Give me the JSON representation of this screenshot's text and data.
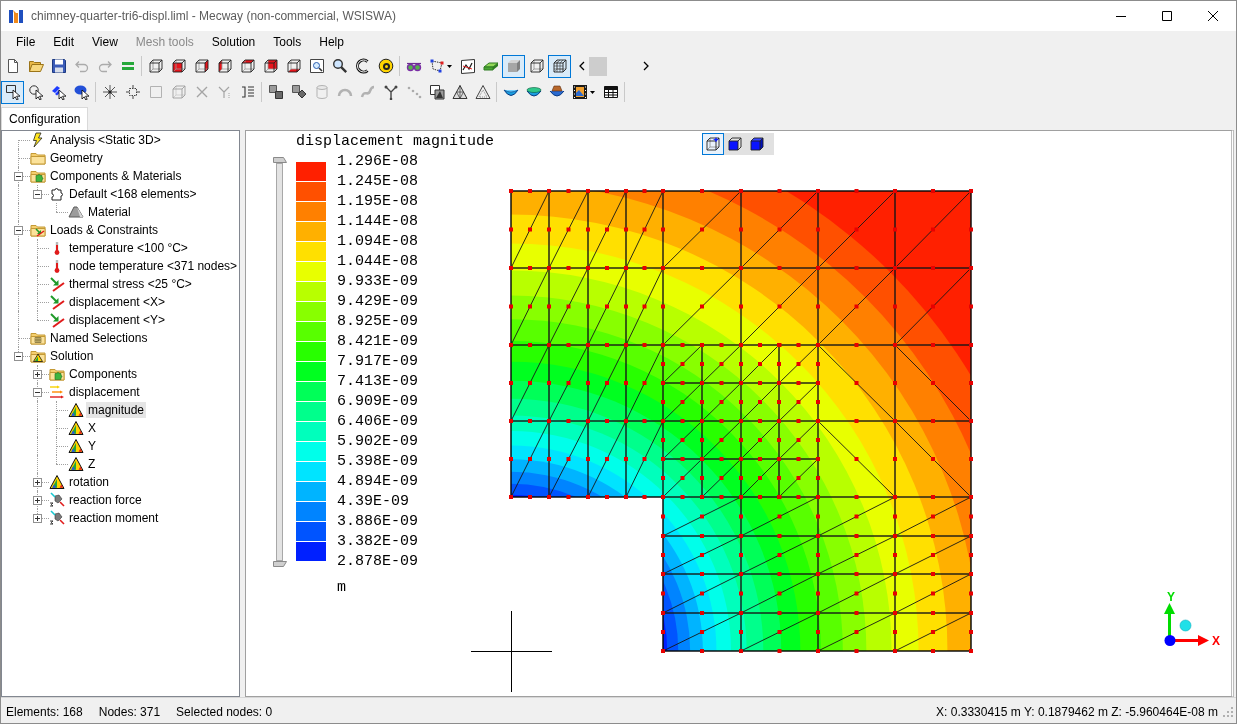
{
  "window": {
    "title": "chimney-quarter-tri6-displ.liml - Mecway (non-commercial, WSISWA)"
  },
  "menu": [
    {
      "label": "File",
      "disabled": false
    },
    {
      "label": "Edit",
      "disabled": false
    },
    {
      "label": "View",
      "disabled": false
    },
    {
      "label": "Mesh tools",
      "disabled": true
    },
    {
      "label": "Solution",
      "disabled": false
    },
    {
      "label": "Tools",
      "disabled": false
    },
    {
      "label": "Help",
      "disabled": false
    }
  ],
  "toolbars": [
    {
      "groups": [
        [
          {
            "selected": false,
            "disabled": false
          },
          {
            "selected": false,
            "disabled": false
          },
          {
            "selected": false,
            "disabled": false
          },
          {
            "selected": false,
            "disabled": true
          },
          {
            "selected": false,
            "disabled": true
          },
          {
            "selected": false,
            "disabled": false
          }
        ],
        [
          {
            "selected": false,
            "disabled": false
          },
          {
            "selected": false,
            "disabled": false
          },
          {
            "selected": false,
            "disabled": false
          },
          {
            "selected": false,
            "disabled": false
          },
          {
            "selected": false,
            "disabled": false
          },
          {
            "selected": false,
            "disabled": false
          },
          {
            "selected": false,
            "disabled": false
          },
          {
            "selected": false,
            "disabled": false
          },
          {
            "selected": false,
            "disabled": false
          },
          {
            "selected": false,
            "disabled": false
          },
          {
            "selected": false,
            "disabled": false
          }
        ],
        [
          {
            "selected": false,
            "disabled": false
          },
          {
            "selected": false,
            "disabled": false
          },
          {
            "selected": false,
            "disabled": false
          },
          {
            "selected": false,
            "disabled": false
          },
          {
            "selected": true,
            "disabled": false
          },
          {
            "selected": false,
            "disabled": false
          },
          {
            "selected": true,
            "disabled": false
          }
        ]
      ]
    },
    {
      "groups": [
        [
          {
            "selected": true,
            "disabled": false
          },
          {
            "selected": false,
            "disabled": false
          },
          {
            "selected": false,
            "disabled": false
          },
          {
            "selected": false,
            "disabled": false
          }
        ],
        [
          {
            "selected": false,
            "disabled": false
          },
          {
            "selected": false,
            "disabled": false
          },
          {
            "selected": false,
            "disabled": true
          },
          {
            "selected": false,
            "disabled": true
          },
          {
            "selected": false,
            "disabled": true
          },
          {
            "selected": false,
            "disabled": true
          },
          {
            "selected": false,
            "disabled": false
          }
        ],
        [
          {
            "selected": false,
            "disabled": false
          },
          {
            "selected": false,
            "disabled": false
          },
          {
            "selected": false,
            "disabled": true
          },
          {
            "selected": false,
            "disabled": true
          },
          {
            "selected": false,
            "disabled": true
          },
          {
            "selected": false,
            "disabled": false
          },
          {
            "selected": false,
            "disabled": true
          },
          {
            "selected": false,
            "disabled": false
          },
          {
            "selected": false,
            "disabled": false
          },
          {
            "selected": false,
            "disabled": false
          }
        ],
        [
          {
            "selected": false,
            "disabled": false
          },
          {
            "selected": false,
            "disabled": false
          },
          {
            "selected": false,
            "disabled": false
          },
          {
            "selected": false,
            "disabled": false
          },
          {
            "selected": false,
            "disabled": false
          }
        ]
      ]
    }
  ],
  "tabs": [
    {
      "label": "Configuration",
      "selected": true
    }
  ],
  "tree": [
    {
      "label": "Analysis <Static 3D>",
      "kind": "analysis",
      "selected": false
    },
    {
      "label": "Geometry",
      "kind": "folder",
      "selected": false
    },
    {
      "label": "Components & Materials",
      "kind": "components",
      "selected": false,
      "expanded": true,
      "children": [
        {
          "label": "Default <168 elements>",
          "kind": "part",
          "selected": false,
          "expanded": true,
          "children": [
            {
              "label": "Material",
              "kind": "material",
              "selected": false
            }
          ]
        }
      ]
    },
    {
      "label": "Loads & Constraints",
      "kind": "loads",
      "selected": false,
      "expanded": true,
      "children": [
        {
          "label": "temperature <100 °C>",
          "kind": "temperature",
          "selected": false
        },
        {
          "label": "node temperature <371 nodes>",
          "kind": "temperature",
          "selected": false
        },
        {
          "label": "thermal stress <25 °C>",
          "kind": "constraint",
          "selected": false
        },
        {
          "label": "displacement <X>",
          "kind": "constraint",
          "selected": false
        },
        {
          "label": "displacement <Y>",
          "kind": "constraint",
          "selected": false
        }
      ]
    },
    {
      "label": "Named Selections",
      "kind": "selections",
      "selected": false
    },
    {
      "label": "Solution",
      "kind": "solution",
      "selected": false,
      "expanded": true,
      "children": [
        {
          "label": "Components",
          "kind": "components",
          "selected": false,
          "expanded": false
        },
        {
          "label": "displacement",
          "kind": "vectors",
          "selected": false,
          "expanded": true,
          "children": [
            {
              "label": "magnitude",
              "kind": "contour",
              "selected": true
            },
            {
              "label": "X",
              "kind": "contour",
              "selected": false
            },
            {
              "label": "Y",
              "kind": "contour",
              "selected": false
            },
            {
              "label": "Z",
              "kind": "contour",
              "selected": false
            }
          ]
        },
        {
          "label": "rotation",
          "kind": "contour",
          "selected": false,
          "expanded": false
        },
        {
          "label": "reaction force",
          "kind": "reaction",
          "selected": false,
          "expanded": false
        },
        {
          "label": "reaction moment",
          "kind": "reaction",
          "selected": false,
          "expanded": false
        }
      ]
    }
  ],
  "view": {
    "view_buttons": [
      {
        "selected": true
      },
      {
        "selected": false
      },
      {
        "selected": false
      }
    ],
    "legend": {
      "title": "displacement magnitude",
      "labels": [
        "1.296E-08",
        "1.245E-08",
        "1.195E-08",
        "1.144E-08",
        "1.094E-08",
        "1.044E-08",
        "9.933E-09",
        "9.429E-09",
        "8.925E-09",
        "8.421E-09",
        "7.917E-09",
        "7.413E-09",
        "6.909E-09",
        "6.406E-09",
        "5.902E-09",
        "5.398E-09",
        "4.894E-09",
        "4.39E-09",
        "3.886E-09",
        "3.382E-09",
        "2.878E-09"
      ],
      "bands": [
        {
          "color": "#ff2000"
        },
        {
          "color": "#ff5000"
        },
        {
          "color": "#ff8000"
        },
        {
          "color": "#ffb000"
        },
        {
          "color": "#ffe000"
        },
        {
          "color": "#e8ff00"
        },
        {
          "color": "#b8ff00"
        },
        {
          "color": "#88ff00"
        },
        {
          "color": "#58ff00"
        },
        {
          "color": "#28ff00"
        },
        {
          "color": "#00ff20"
        },
        {
          "color": "#00ff58"
        },
        {
          "color": "#00ff8c"
        },
        {
          "color": "#00ffbc"
        },
        {
          "color": "#00ffea"
        },
        {
          "color": "#00e4ff"
        },
        {
          "color": "#00b4ff"
        },
        {
          "color": "#0084ff"
        },
        {
          "color": "#0054ff"
        },
        {
          "color": "#0020ff"
        }
      ],
      "unit": "m"
    },
    "axes": {
      "x_label": "X",
      "y_label": "Y"
    }
  },
  "status_bar": {
    "items": [
      "Elements: 168",
      "Nodes: 371",
      "Selected nodes: 0"
    ],
    "coordinates": "X: 0.3330415 m Y: 0.1879462 m Z: -5.960464E-08 m"
  }
}
